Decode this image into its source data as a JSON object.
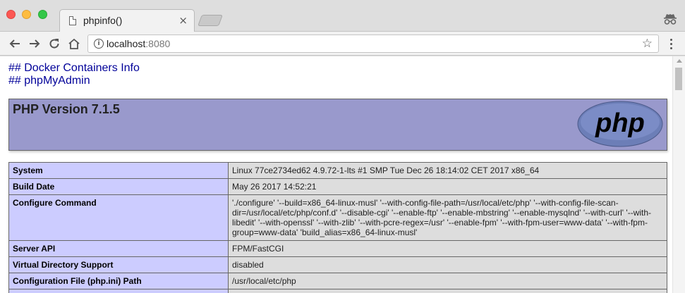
{
  "browser": {
    "tab_title": "phpinfo()",
    "tab_close": "×",
    "url_host": "localhost",
    "url_port": ":8080",
    "star_glyph": "☆"
  },
  "page": {
    "links": [
      "## Docker Containers Info",
      "## phpMyAdmin"
    ],
    "php_version": "PHP Version 7.1.5",
    "logo_text": "php",
    "colors": {
      "header_bg": "#9999cc",
      "key_bg": "#ccccff",
      "value_bg": "#dddddd",
      "link": "#000099"
    },
    "table": [
      {
        "key": "System",
        "value": "Linux 77ce2734ed62 4.9.72-1-lts #1 SMP Tue Dec 26 18:14:02 CET 2017 x86_64"
      },
      {
        "key": "Build Date",
        "value": "May 26 2017 14:52:21"
      },
      {
        "key": "Configure Command",
        "value": "'./configure' '--build=x86_64-linux-musl' '--with-config-file-path=/usr/local/etc/php' '--with-config-file-scan-dir=/usr/local/etc/php/conf.d' '--disable-cgi' '--enable-ftp' '--enable-mbstring' '--enable-mysqlnd' '--with-curl' '--with-libedit' '--with-openssl' '--with-zlib' '--with-pcre-regex=/usr' '--enable-fpm' '--with-fpm-user=www-data' '--with-fpm-group=www-data' 'build_alias=x86_64-linux-musl'"
      },
      {
        "key": "Server API",
        "value": "FPM/FastCGI"
      },
      {
        "key": "Virtual Directory Support",
        "value": "disabled"
      },
      {
        "key": "Configuration File (php.ini) Path",
        "value": "/usr/local/etc/php"
      },
      {
        "key": "",
        "value": ""
      }
    ]
  }
}
